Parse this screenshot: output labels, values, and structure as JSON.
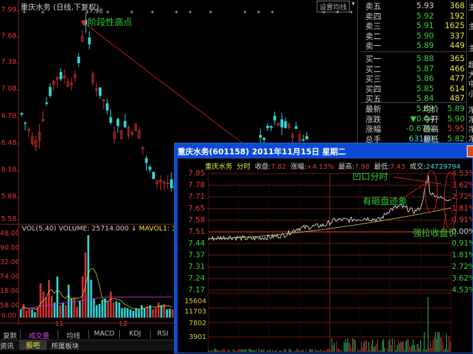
{
  "daily": {
    "title": "重庆水务 (日线,下复权)",
    "set_ma_button": "设置均线",
    "high_marker": "7.98",
    "annotation": "阶段性高点",
    "price_axis": [
      "7.99",
      "7.68",
      "7.38",
      "7.08",
      "6.78",
      "6.48",
      "6.18",
      "5.88",
      "5.58"
    ],
    "vol_header": {
      "label": "VOL(5,40)",
      "volume": "VOLUME: 25714.000",
      "arrow": "↓",
      "mavol": "MAVOL1: 35248.2"
    },
    "vol_axis": [
      "48.00",
      "90.00",
      "32.00",
      "74.00",
      "16.00",
      "58.00",
      "0.00"
    ],
    "months": [
      "11",
      "12"
    ],
    "tabs": [
      "复默认",
      "成交量",
      "均线",
      "MACD",
      "KDJ",
      "RSI"
    ],
    "bottom_tabs": [
      "资讯",
      "股吧",
      "所属板块"
    ]
  },
  "quote": {
    "asks": [
      {
        "label": "卖五",
        "price": "5.93",
        "vol": "368"
      },
      {
        "label": "卖四",
        "price": "5.92",
        "vol": "192"
      },
      {
        "label": "卖三",
        "price": "5.91",
        "vol": "1625"
      },
      {
        "label": "卖二",
        "price": "5.90",
        "vol": "337"
      },
      {
        "label": "卖一",
        "price": "5.89",
        "vol": "449"
      }
    ],
    "bids": [
      {
        "label": "买一",
        "price": "5.88",
        "vol": "365"
      },
      {
        "label": "买二",
        "price": "5.87",
        "vol": "466"
      },
      {
        "label": "买三",
        "price": "5.86",
        "vol": "477"
      },
      {
        "label": "买四",
        "price": "5.85",
        "vol": "614"
      },
      {
        "label": "买五",
        "price": "5.84",
        "vol": "487"
      }
    ],
    "stats": [
      {
        "l1": "最新",
        "v1": "5.89",
        "l2": "均价",
        "v2": "5.89"
      },
      {
        "l1": "涨跌",
        "v1": "▼0.04",
        "l2": "今开",
        "v2": "5.90"
      },
      {
        "l1": "涨幅",
        "v1": "-0.67%",
        "l2": "最高",
        "v2": "5.95"
      },
      {
        "l1": "总手",
        "v1": "63160",
        "l2": "最低",
        "v2": "5.82"
      }
    ],
    "side": [
      "主",
      "主",
      "主",
      "超",
      "大",
      "中",
      "小",
      "净",
      "净",
      "净",
      "净"
    ]
  },
  "popup": {
    "title": "重庆水务(601158) 2011年11月15日 星期二",
    "header": {
      "name": "重庆水务",
      "mode": "分时",
      "close_label": "收盘:",
      "close": "7.82",
      "chg_label": "涨幅:",
      "chg": "+4.13%",
      "high_label": "最高:",
      "high": "7.98",
      "low_label": "最低:",
      "low": "7.43",
      "vol_label": "成交:",
      "vol": "24729794"
    },
    "price_axis": [
      "7.85",
      "7.78",
      "7.71",
      "7.65",
      "7.58",
      "7.51",
      "7.44",
      "7.37",
      "7.31",
      "7.24",
      "7.17"
    ],
    "pct_axis": [
      "4.53%",
      "3.62%",
      "2.72%",
      "1.81%",
      "0.91%",
      "0.00%",
      "0.91%",
      "1.81%",
      "2.72%",
      "3.62%",
      "4.53%"
    ],
    "vol_axis": [
      "15604",
      "11703",
      "7802",
      "3901"
    ],
    "annotations": [
      "凹口分时",
      "有砸盘迹象",
      "强拉收盘价"
    ]
  }
}
